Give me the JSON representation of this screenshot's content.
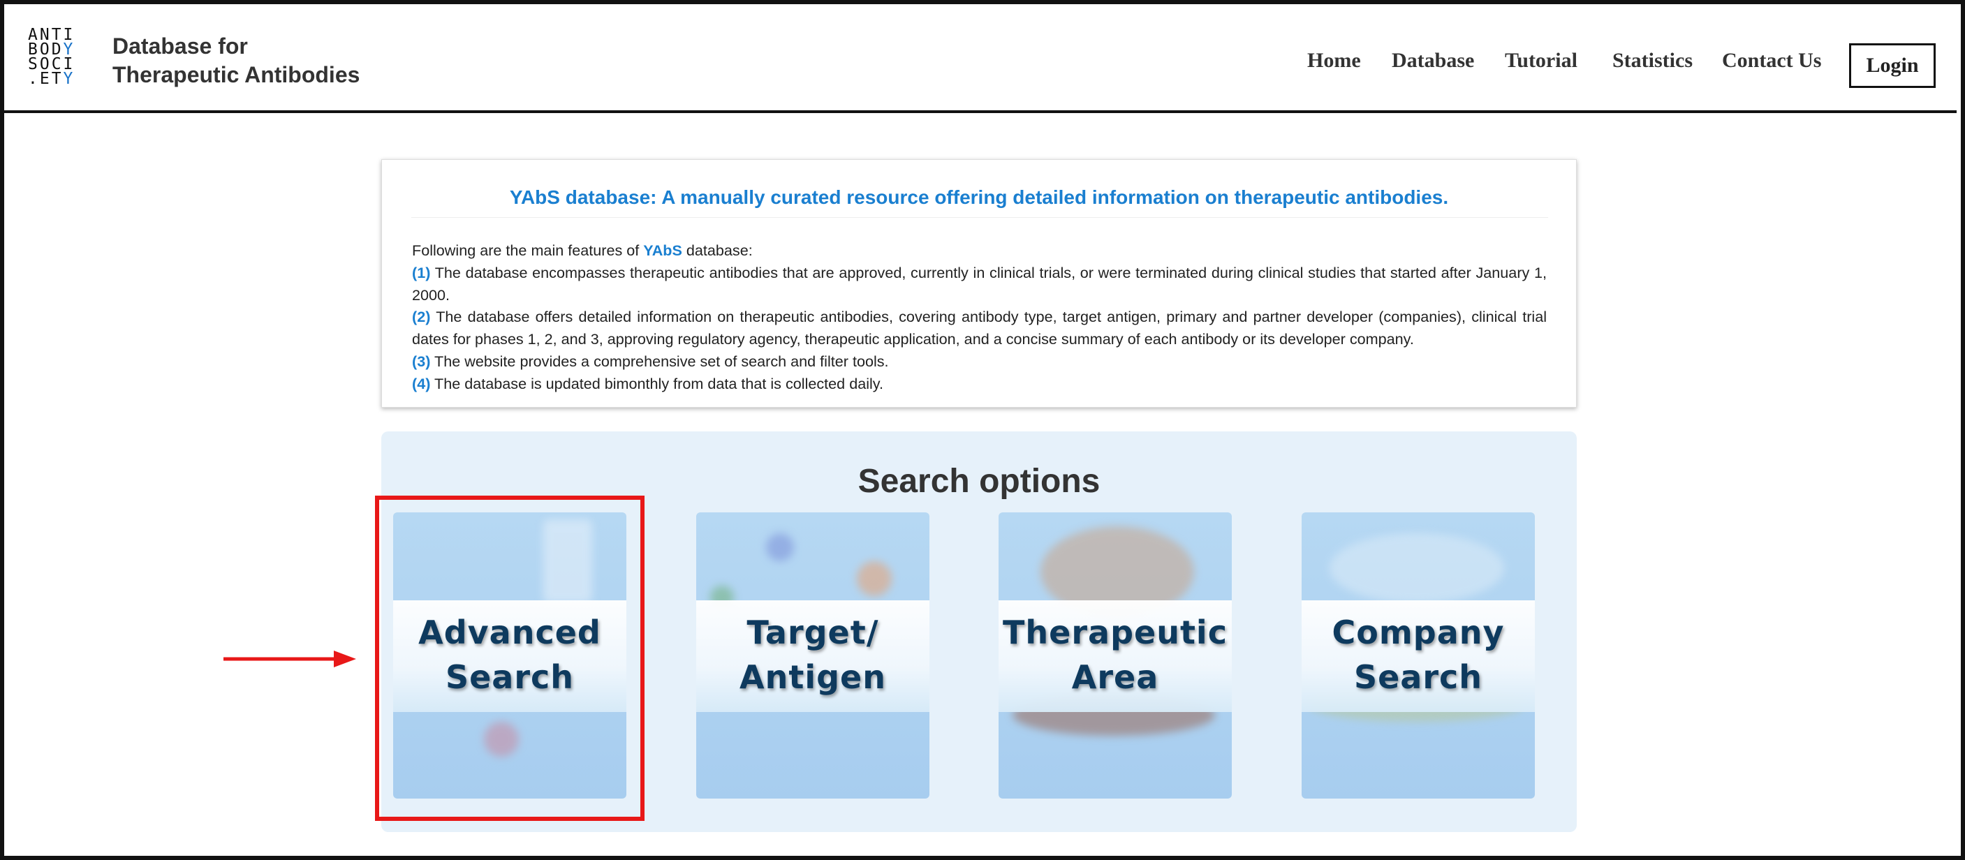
{
  "logo": {
    "rows": [
      [
        {
          "t": "ANTI",
          "b": false
        }
      ],
      [
        {
          "t": "BOD",
          "b": false
        },
        {
          "t": "Y",
          "b": true
        }
      ],
      [
        {
          "t": "SOCI",
          "b": false
        }
      ],
      [
        {
          "t": ".ET",
          "b": false
        },
        {
          "t": "Y",
          "b": true
        }
      ]
    ],
    "accent": "#1a73c8"
  },
  "brand": {
    "line1": "Database for",
    "line2": "Therapeutic Antibodies"
  },
  "nav": {
    "home": "Home",
    "database": "Database",
    "tutorial": "Tutorial",
    "statistics": "Statistics",
    "contact": "Contact Us",
    "login": "Login"
  },
  "intro": {
    "title": "YAbS database: A manually curated resource offering detailed information on therapeutic antibodies.",
    "lead_before": "Following are the main features of ",
    "lead_highlight": "YAbS",
    "lead_after": " database:",
    "features": [
      {
        "num": "(1)",
        "text": " The database encompasses therapeutic antibodies that are approved, currently in clinical trials, or were terminated during clinical studies that started after January 1, 2000."
      },
      {
        "num": "(2)",
        "text": " The database offers detailed information on therapeutic antibodies, covering antibody type, target antigen, primary and partner developer (companies), clinical trial dates for phases 1, 2, and 3, approving regulatory agency, therapeutic application, and a concise summary of each antibody or its developer company."
      },
      {
        "num": "(3)",
        "text": " The website provides a comprehensive set of search and filter tools."
      },
      {
        "num": "(4)",
        "text": " The database is updated bimonthly from data that is collected daily."
      }
    ],
    "accent_color": "#1a7fd0"
  },
  "search": {
    "title": "Search options",
    "tiles": [
      {
        "label": "Advanced\nSearch",
        "icon": "advanced-search-illustration"
      },
      {
        "label": "Target/\nAntigen",
        "icon": "target-antigen-illustration"
      },
      {
        "label": "Therapeutic\nArea",
        "icon": "therapeutic-area-illustration"
      },
      {
        "label": "Company\nSearch",
        "icon": "company-search-illustration"
      }
    ]
  },
  "annotation": {
    "highlight_color": "#e81818"
  }
}
